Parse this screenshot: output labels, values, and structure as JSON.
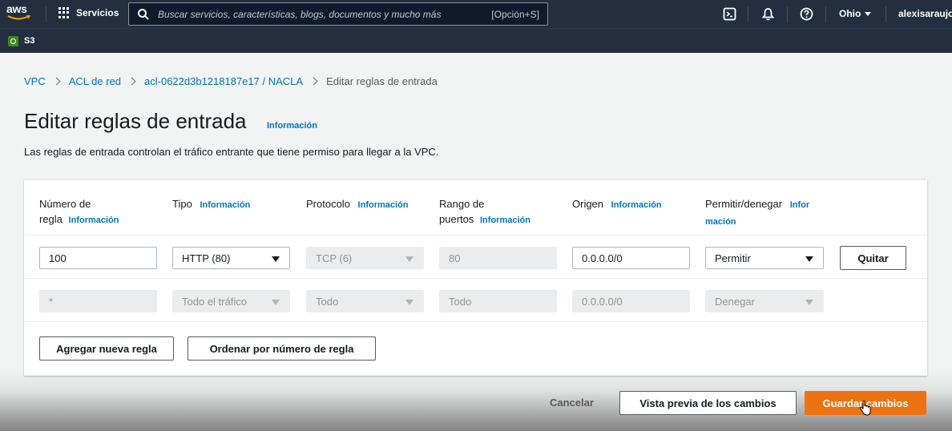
{
  "topnav": {
    "logo_text": "aws",
    "services_label": "Servicios",
    "search_placeholder": "Buscar servicios, características, blogs, documentos y mucho más",
    "search_shortcut": "[Opción+S]",
    "region": "Ohio",
    "user": "alexisaraujor"
  },
  "subbar": {
    "service_label": "S3"
  },
  "breadcrumb": {
    "items": [
      "VPC",
      "ACL de red",
      "acl-0622d3b1218187e17 / NACLA"
    ],
    "current": "Editar reglas de entrada"
  },
  "header": {
    "title": "Editar reglas de entrada",
    "info": "Información",
    "description": "Las reglas de entrada controlan el tráfico entrante que tiene permiso para llegar a la VPC."
  },
  "columns": {
    "rule_number": "Número de\nregla",
    "type": "Tipo",
    "protocol": "Protocolo",
    "port_range": "Rango de\npuertos",
    "source": "Origen",
    "allow_deny_a": "Permitir/denegar",
    "info": "Información",
    "info_split_a": "Infor",
    "info_split_b": "mación"
  },
  "rules": [
    {
      "rule_number": "100",
      "type": "HTTP (80)",
      "protocol": "TCP (6)",
      "port_range": "80",
      "source": "0.0.0.0/0",
      "action": "Permitir",
      "remove_label": "Quitar"
    },
    {
      "rule_number": "*",
      "type": "Todo el tráfico",
      "protocol": "Todo",
      "port_range": "Todo",
      "source": "0.0.0.0/0",
      "action": "Denegar"
    }
  ],
  "panel_actions": {
    "add_rule": "Agregar nueva regla",
    "sort_rules": "Ordenar por número de regla"
  },
  "footer": {
    "cancel": "Cancelar",
    "preview": "Vista previa de los cambios",
    "save": "Guardar cambios"
  },
  "colors": {
    "nav_bg": "#232f3e",
    "link": "#0073bb",
    "primary": "#ec7211"
  }
}
